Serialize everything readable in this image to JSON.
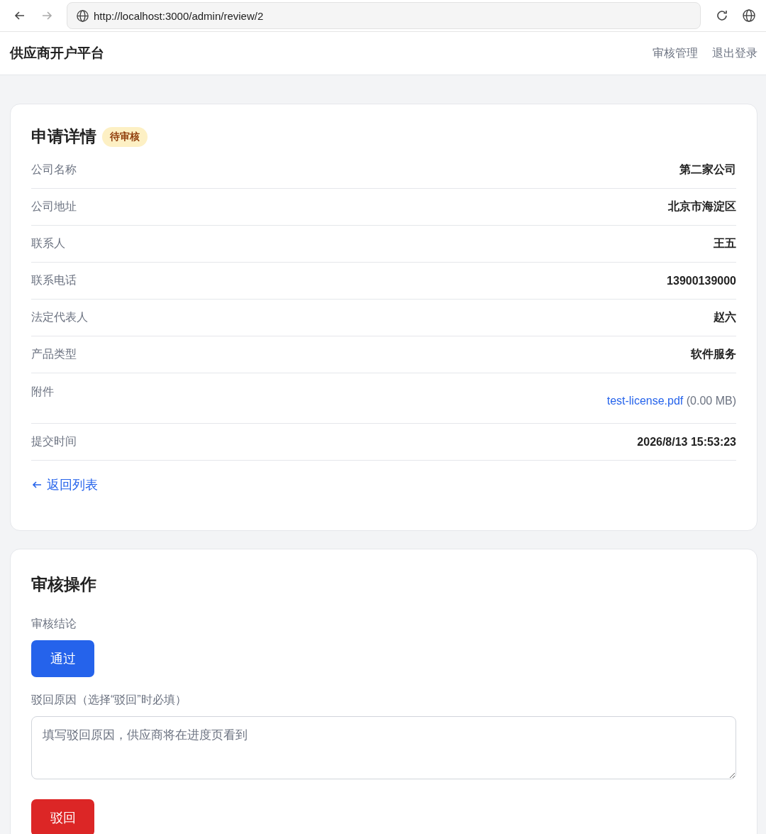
{
  "browser": {
    "url": "http://localhost:3000/admin/review/2"
  },
  "header": {
    "title": "供应商开户平台",
    "nav": [
      "审核管理",
      "退出登录"
    ]
  },
  "details": {
    "title": "申请详情",
    "status": {
      "label": "待审核",
      "kind": "pending"
    },
    "rows": [
      {
        "label": "公司名称",
        "value": "第二家公司"
      },
      {
        "label": "公司地址",
        "value": "北京市海淀区"
      },
      {
        "label": "联系人",
        "value": "王五"
      },
      {
        "label": "联系电话",
        "value": "13900139000"
      },
      {
        "label": "法定代表人",
        "value": "赵六"
      },
      {
        "label": "产品类型",
        "value": "软件服务"
      },
      {
        "label": "附件",
        "kind": "file",
        "file": "test-license.pdf",
        "size": "(0.00 MB)"
      },
      {
        "label": "提交时间",
        "value": "2026/8/13 15:53:23"
      }
    ],
    "back_link": "返回列表"
  },
  "review": {
    "title": "审核操作",
    "conclusion_label": "审核结论",
    "approve_button": "通过",
    "reason_label": "驳回原因（选择“驳回”时必填）",
    "reason_placeholder": "填写驳回原因，供应商将在进度页看到",
    "reject_button": "驳回"
  }
}
